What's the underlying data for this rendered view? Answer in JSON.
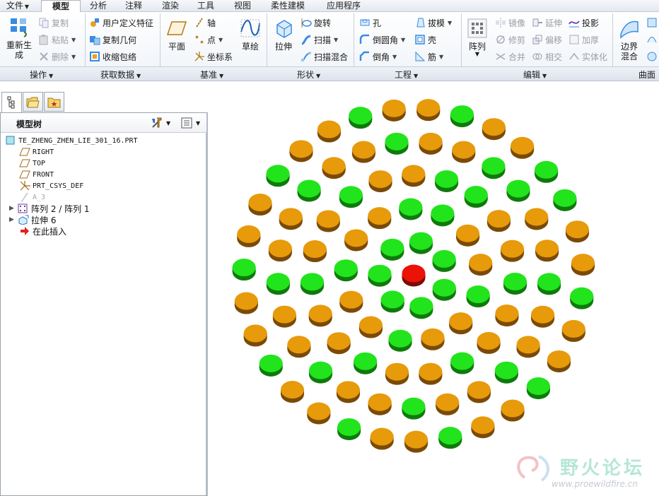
{
  "menu_tabs": [
    {
      "label": "文件",
      "has_caret": true,
      "active": false
    },
    {
      "label": "模型",
      "active": true
    },
    {
      "label": "分析",
      "active": false
    },
    {
      "label": "注释",
      "active": false
    },
    {
      "label": "渲染",
      "active": false
    },
    {
      "label": "工具",
      "active": false
    },
    {
      "label": "视图",
      "active": false
    },
    {
      "label": "柔性建模",
      "active": false
    },
    {
      "label": "应用程序",
      "active": false
    }
  ],
  "ribbon": {
    "operations": {
      "group_label": "操作",
      "regenerate": "重新生\n成",
      "copy": "复制",
      "paste": "粘贴",
      "delete": "删除"
    },
    "get_data": {
      "group_label": "获取数据",
      "user_defined_feature": "用户定义特征",
      "copy_geometry": "复制几何",
      "shrinkwrap": "收缩包络"
    },
    "datum": {
      "group_label": "基准",
      "plane": "平面",
      "axis": "轴",
      "point": "点",
      "csys": "坐标系",
      "sketch": "草绘"
    },
    "shapes": {
      "group_label": "形状",
      "extrude": "拉伸",
      "revolve": "旋转",
      "sweep": "扫描",
      "swept_blend": "扫描混合"
    },
    "engineering": {
      "group_label": "工程",
      "hole": "孔",
      "round": "倒圆角",
      "chamfer": "倒角",
      "draft": "拔模",
      "shell": "壳",
      "rib": "筋"
    },
    "editing": {
      "group_label": "编辑",
      "pattern": "阵列",
      "mirror": "镜像",
      "trim": "修剪",
      "merge": "合并",
      "extend": "延伸",
      "offset": "偏移",
      "intersect": "相交",
      "project": "投影",
      "thicken": "加厚",
      "solidify": "实体化"
    },
    "surfaces": {
      "group_label": "曲面",
      "boundary_blend": "边界\n混合"
    }
  },
  "model_tree": {
    "title": "模型树",
    "nodes": [
      {
        "label": "TE_ZHENG_ZHEN_LIE_301_16.PRT",
        "icon": "part-icon",
        "level": 0,
        "expandable": false,
        "dim": false
      },
      {
        "label": "RIGHT",
        "icon": "datum-plane-icon",
        "level": 1,
        "expandable": false,
        "dim": false
      },
      {
        "label": "TOP",
        "icon": "datum-plane-icon",
        "level": 1,
        "expandable": false,
        "dim": false
      },
      {
        "label": "FRONT",
        "icon": "datum-plane-icon",
        "level": 1,
        "expandable": false,
        "dim": false
      },
      {
        "label": "PRT_CSYS_DEF",
        "icon": "csys-icon",
        "level": 1,
        "expandable": false,
        "dim": false
      },
      {
        "label": "A_3",
        "icon": "datum-axis-icon",
        "level": 1,
        "expandable": false,
        "dim": true
      },
      {
        "label": "阵列 2 / 阵列 1",
        "icon": "pattern-icon",
        "level": 1,
        "expandable": true,
        "dim": false
      },
      {
        "label": "拉伸 6",
        "icon": "extrude-icon",
        "level": 1,
        "expandable": true,
        "dim": false
      },
      {
        "label": "在此插入",
        "icon": "insert-arrow-icon",
        "level": 1,
        "expandable": false,
        "dim": false
      }
    ]
  },
  "graphics": {
    "colors": {
      "green_top": "#22e41c",
      "green_side": "#0f7a0c",
      "orange_top": "#e79a0a",
      "orange_side": "#7a4a06",
      "red_top": "#ec1208",
      "red_side": "#7e0a04"
    }
  },
  "watermark": {
    "text": "野火论坛",
    "url": "www.proewildfire.cn"
  }
}
